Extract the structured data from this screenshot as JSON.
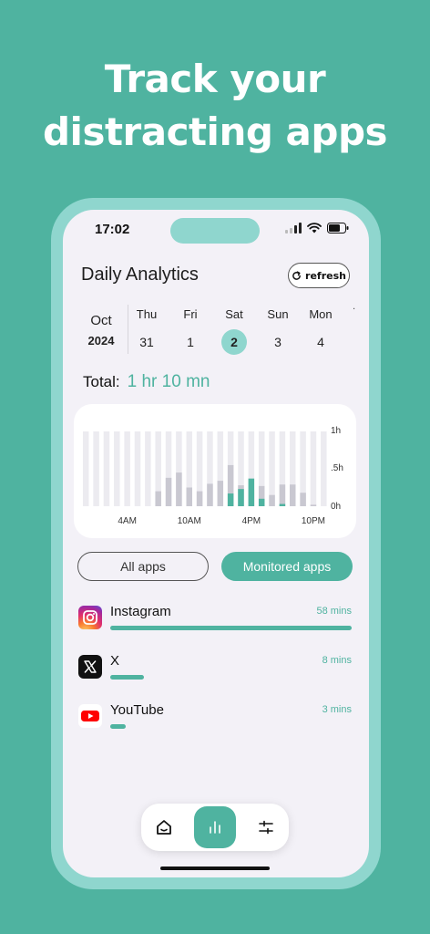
{
  "headline": {
    "line1": "Track your",
    "line2": "distracting apps"
  },
  "status_bar": {
    "time": "17:02"
  },
  "header": {
    "title": "Daily Analytics",
    "refresh_label": "refresh"
  },
  "calendar": {
    "month": "Oct",
    "year": "2024",
    "days": [
      {
        "name": "Thu",
        "date": "31",
        "selected": false
      },
      {
        "name": "Fri",
        "date": "1",
        "selected": false
      },
      {
        "name": "Sat",
        "date": "2",
        "selected": true
      },
      {
        "name": "Sun",
        "date": "3",
        "selected": false
      },
      {
        "name": "Mon",
        "date": "4",
        "selected": false
      }
    ],
    "more_marker": "·"
  },
  "total": {
    "label": "Total:",
    "value": "1 hr 10 mn"
  },
  "colors": {
    "accent": "#4fb3a0",
    "accent_light": "#8fd6ce",
    "background": "#f3f1f7",
    "bar_grey": "#c9c8d1",
    "bar_track": "#ecebf0"
  },
  "chart_data": {
    "type": "bar",
    "categories": [
      "12AM",
      "1AM",
      "2AM",
      "3AM",
      "4AM",
      "5AM",
      "6AM",
      "7AM",
      "8AM",
      "9AM",
      "10AM",
      "11AM",
      "12PM",
      "1PM",
      "2PM",
      "3PM",
      "4PM",
      "5PM",
      "6PM",
      "7PM",
      "8PM",
      "9PM",
      "10PM",
      "11PM"
    ],
    "series": [
      {
        "values": [
          0,
          0,
          0,
          0,
          0,
          0,
          0,
          0,
          0,
          0,
          0,
          0,
          0,
          0,
          0.17,
          0.23,
          0.37,
          0.1,
          0,
          0.03,
          0,
          0,
          0,
          0
        ]
      },
      {
        "values": [
          0,
          0,
          0,
          0,
          0,
          0,
          0,
          0.2,
          0.38,
          0.45,
          0.25,
          0.2,
          0.3,
          0.34,
          0.55,
          0.28,
          0.22,
          0.27,
          0.15,
          0.29,
          0.29,
          0.18,
          0.02,
          0
        ]
      }
    ],
    "x_tick_labels": [
      "4AM",
      "10AM",
      "4PM",
      "10PM"
    ],
    "y_tick_labels": [
      "1h",
      ".5h",
      "0h"
    ],
    "ylim": [
      0,
      1
    ],
    "grid": false
  },
  "filters": {
    "all_label": "All apps",
    "monitored_label": "Monitored apps",
    "active": "monitored"
  },
  "apps": [
    {
      "name": "Instagram",
      "time": "58 mins",
      "usage_fraction": 1.0,
      "icon": "instagram-icon"
    },
    {
      "name": "X",
      "time": "8 mins",
      "usage_fraction": 0.14,
      "icon": "x-icon"
    },
    {
      "name": "YouTube",
      "time": "3 mins",
      "usage_fraction": 0.065,
      "icon": "youtube-icon"
    }
  ],
  "tabbar": {
    "items": [
      "home-icon",
      "stats-icon",
      "settings-icon"
    ],
    "active": "stats-icon"
  }
}
